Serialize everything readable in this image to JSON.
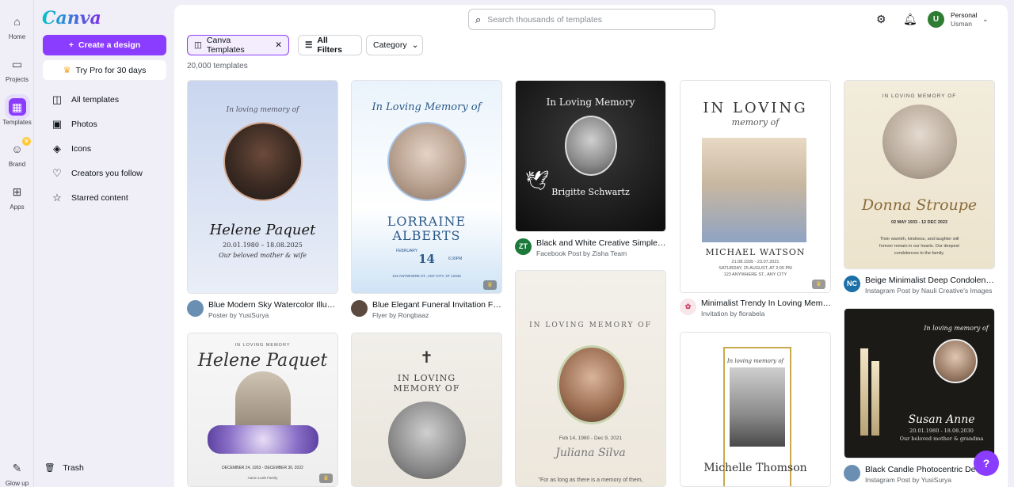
{
  "rail": {
    "items": [
      {
        "label": "Home",
        "icon": "home-icon"
      },
      {
        "label": "Projects",
        "icon": "folder-icon"
      },
      {
        "label": "Templates",
        "icon": "templates-icon"
      },
      {
        "label": "Brand",
        "icon": "brand-icon"
      },
      {
        "label": "Apps",
        "icon": "apps-icon"
      }
    ],
    "glow_up": "Glow up"
  },
  "panel": {
    "logo": "Canva",
    "create_label": "Create a design",
    "pro_label": "Try Pro for 30 days",
    "nav": [
      {
        "label": "All templates",
        "icon": "templates-outline-icon"
      },
      {
        "label": "Photos",
        "icon": "image-icon"
      },
      {
        "label": "Icons",
        "icon": "shapes-icon"
      },
      {
        "label": "Creators you follow",
        "icon": "heart-icon"
      },
      {
        "label": "Starred content",
        "icon": "star-icon"
      }
    ],
    "trash": "Trash"
  },
  "header": {
    "search_placeholder": "Search thousands of templates",
    "account_name": "Personal",
    "account_user": "Usman",
    "avatar_initial": "U"
  },
  "filters": {
    "chip_selected": "Canva Templates",
    "all_filters": "All Filters",
    "category": "Category"
  },
  "count_text": "20,000 templates",
  "cards": [
    {
      "title": "Blue Modern Sky Watercolor Illustrati...",
      "sub": "Poster by YusiSurya",
      "thumb_text": [
        "In loving memory of",
        "Helene Paquet",
        "20.01.1980 – 18.08.2025",
        "Our beloved mother & wife"
      ]
    },
    {
      "title": "Blue Elegant Funeral Invitation Flyer",
      "sub": "Flyer by Rongbaaz",
      "thumb_text": [
        "In Loving Memory of",
        "LORRAINE",
        "ALBERTS",
        "FEBRUARY",
        "14",
        "6:30PM",
        "123 ANYWHERE ST., ANY CITY, ST 12345"
      ]
    },
    {
      "title": "Black and White Creative Simple Co...",
      "sub": "Facebook Post by Zisha Team",
      "avatar": "ZT",
      "thumb_text": [
        "In Loving Memory",
        "Brigitte Schwartz"
      ]
    },
    {
      "title": "Minimalist Trendy In Loving Memory...",
      "sub": "Invitation by florabela",
      "thumb_text": [
        "IN LOVING",
        "memory of",
        "MICHAEL WATSON",
        "21.08.1935 - 23.07.2021",
        "SATURDAY, 25 AUGUST, AT 2:00 PM",
        "123 ANYWHERE ST., ANY CITY"
      ]
    },
    {
      "title": "Beige Minimalist Deep Condolence...",
      "sub": "Instagram Post by Nauli Creative's Images",
      "avatar": "NC",
      "thumb_text": [
        "IN LOVING MEMORY OF",
        "Donna Stroupe",
        "02 MAY 1933 - 12 DEC 2023",
        "Their warmth, kindness, and laughter will",
        "forever remain in our hearts. Our deepest",
        "condolences to the family."
      ]
    },
    {
      "title": "",
      "sub": "",
      "thumb_text": [
        "IN LOVING MEMORY",
        "Helene Paquet",
        "DECEMBER 24, 1953 - DECEMBER 30, 2022",
        "Aaron Loeb Family"
      ]
    },
    {
      "title": "",
      "sub": "",
      "thumb_text": [
        "IN LOVING",
        "MEMORY OF"
      ]
    },
    {
      "title": "",
      "sub": "",
      "thumb_text": [
        "IN LOVING MEMORY OF",
        "Feb 14, 1980 - Dec 9, 2021",
        "Juliana Silva",
        "\"For as long as there is a memory of them,"
      ]
    },
    {
      "title": "",
      "sub": "",
      "thumb_text": [
        "In loving memory of",
        "Michelle Thomson"
      ]
    },
    {
      "title": "Black Candle Photocentric Deep",
      "sub": "Instagram Post by YusiSurya",
      "thumb_text": [
        "In loving memory of",
        "Susan Anne",
        "20.01.1980 - 18.08.2030",
        "Our beloved mother & grandma"
      ]
    }
  ],
  "help_label": "?"
}
